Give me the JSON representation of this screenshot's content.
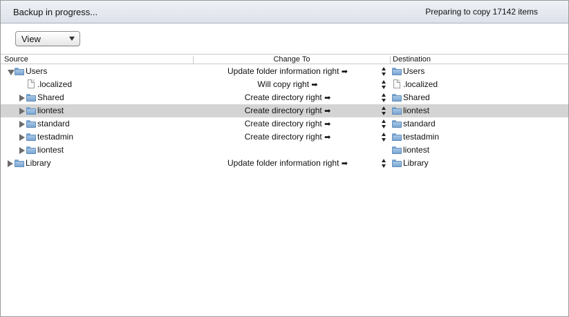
{
  "status": {
    "left_text": "Backup in progress...",
    "right_text": "Preparing to copy 17142 items"
  },
  "toolbar": {
    "view_label": "View"
  },
  "columns": {
    "source": "Source",
    "change_to": "Change To",
    "destination": "Destination"
  },
  "rows": [
    {
      "source": "Users",
      "change": "Update folder information right",
      "dest": "Users"
    },
    {
      "source": ".localized",
      "change": "Will copy right",
      "dest": ".localized"
    },
    {
      "source": "Shared",
      "change": "Create directory right",
      "dest": "Shared"
    },
    {
      "source": "liontest",
      "change": "Create directory right",
      "dest": "liontest"
    },
    {
      "source": "standard",
      "change": "Create directory right",
      "dest": "standard"
    },
    {
      "source": "testadmin",
      "change": "Create directory right",
      "dest": "testadmin"
    },
    {
      "source": "liontest",
      "change": "",
      "dest": "liontest"
    },
    {
      "source": "Library",
      "change": "Update folder information right",
      "dest": "Library"
    }
  ],
  "arrow_symbol": "➡",
  "colors": {
    "selected_row": "#d4d4d4",
    "folder": "#7aa6d2"
  }
}
